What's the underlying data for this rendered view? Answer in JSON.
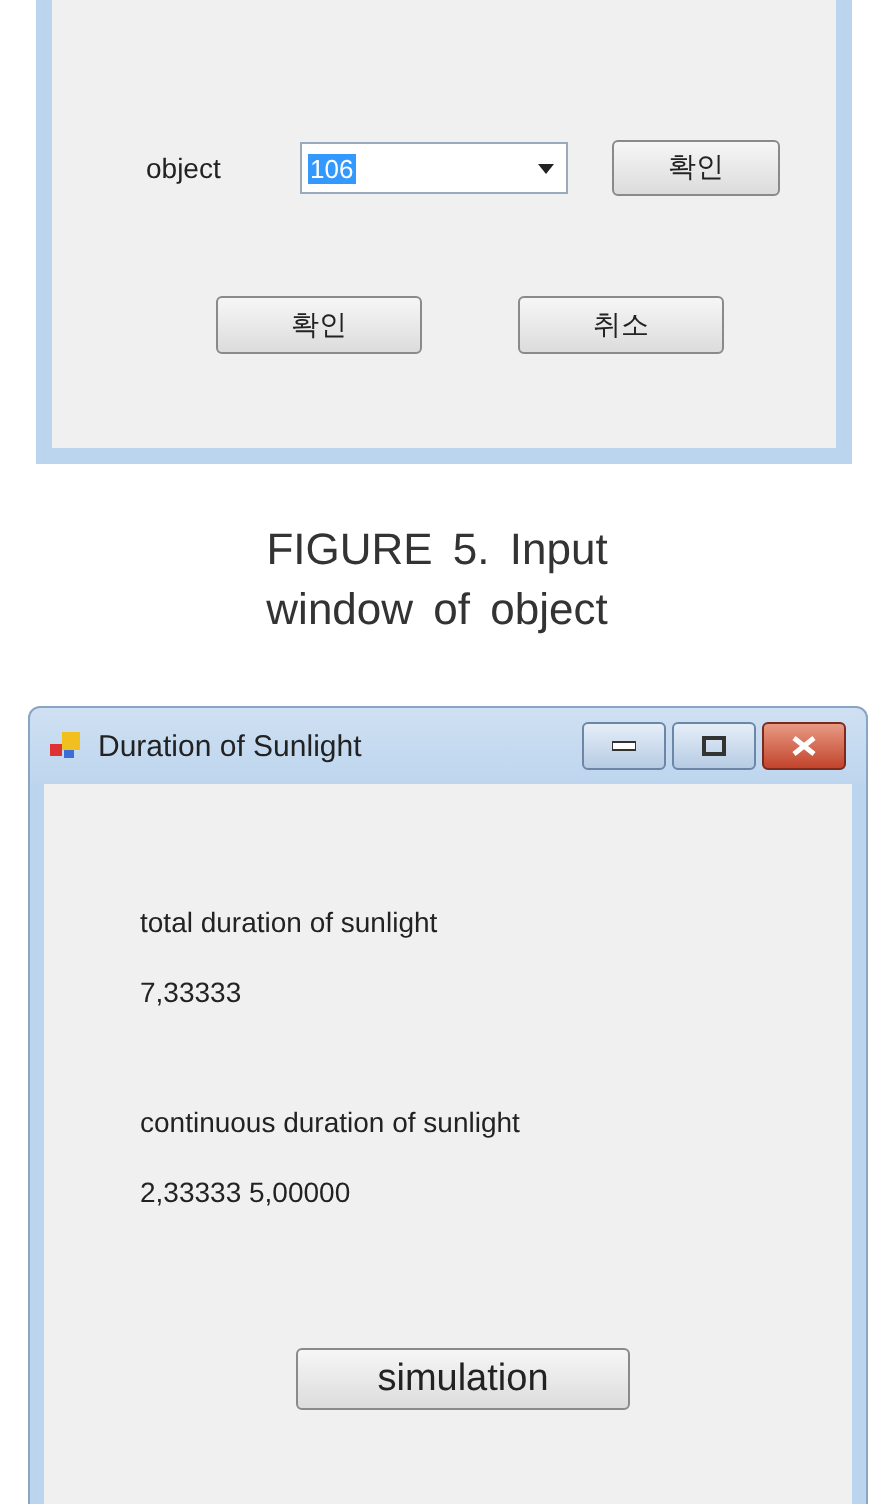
{
  "input_window": {
    "object_label": "object",
    "object_combo": {
      "value": "106",
      "selected": true
    },
    "combo_confirm_button": "확인",
    "buttons": [
      "확인",
      "취소"
    ]
  },
  "caption": "FIGURE 5. Input window of object",
  "sunlight_window": {
    "title": "Duration of Sunlight",
    "fields": [
      {
        "label": "total duration of sunlight",
        "value": "7,33333"
      },
      {
        "label": "continuous duration of sunlight",
        "value": "2,33333 5,00000"
      }
    ],
    "button": "simulation"
  }
}
